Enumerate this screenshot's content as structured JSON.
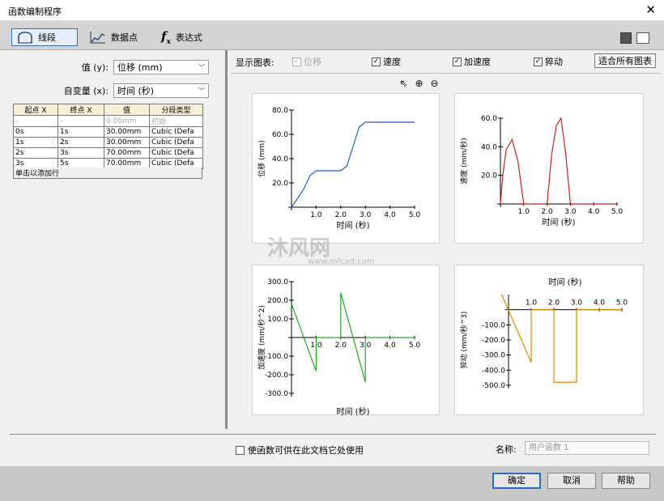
{
  "window": {
    "title": "函数编制程序"
  },
  "toolbar": {
    "tabs": [
      {
        "label": "线段"
      },
      {
        "label": "数据点"
      },
      {
        "label": "表达式"
      }
    ]
  },
  "left": {
    "value_label": "值 (y):",
    "value_select": "位移 (mm)",
    "indep_label": "自变量 (x):",
    "indep_select": "时间 (秒)",
    "table": {
      "headers": [
        "起点 X",
        "终点 X",
        "值",
        "分段类型"
      ],
      "rows": [
        [
          "-",
          "-",
          "0.00mm",
          "初始"
        ],
        [
          "0s",
          "1s",
          "30.00mm",
          "Cubic (Defa"
        ],
        [
          "1s",
          "2s",
          "30.00mm",
          "Cubic (Defa"
        ],
        [
          "2s",
          "3s",
          "70.00mm",
          "Cubic (Defa"
        ],
        [
          "3s",
          "5s",
          "70.00mm",
          "Cubic (Defa"
        ]
      ],
      "add_row": "单击以添加行"
    }
  },
  "right": {
    "show_label": "显示图表:",
    "checks": [
      {
        "label": "位移",
        "checked": true,
        "disabled": true
      },
      {
        "label": "速度",
        "checked": true
      },
      {
        "label": "加速度",
        "checked": true
      },
      {
        "label": "猝动",
        "checked": true
      }
    ],
    "fit_button": "适合所有图表"
  },
  "watermark": {
    "logo": "沐风网",
    "url": "www.mfcad.com"
  },
  "bottom": {
    "use_option": "使函数可供在此文档它处使用",
    "name_label": "名称:",
    "name_placeholder": "用户函数 1"
  },
  "buttons": {
    "ok": "确定",
    "cancel": "取消",
    "help": "帮助"
  },
  "colors": {
    "displacement": "#1f5fbf",
    "velocity": "#cc2222",
    "acceleration": "#22aa22",
    "jerk": "#e08a00",
    "active_tab": "#3a6ea5"
  },
  "chart_data": [
    {
      "type": "line",
      "name_key": "displacement",
      "ylabel": "位移 (mm)",
      "xlabel": "时间 (秒)",
      "xlim": [
        0,
        5
      ],
      "ylim": [
        0,
        80
      ],
      "xticks": [
        "1.0",
        "2.0",
        "3.0",
        "4.0",
        "5.0"
      ],
      "yticks": [
        "20.0",
        "40.0",
        "60.0",
        "80.0"
      ],
      "x": [
        0,
        0.25,
        0.5,
        0.75,
        1,
        1.5,
        2,
        2.25,
        2.5,
        2.75,
        3,
        4,
        5
      ],
      "y": [
        0,
        7.5,
        15,
        26,
        30,
        30,
        30,
        34,
        50,
        66,
        70,
        70,
        70
      ]
    },
    {
      "type": "line",
      "name_key": "velocity",
      "ylabel": "速度 (mm/秒)",
      "xlabel": "时间 (秒)",
      "xlim": [
        0,
        5
      ],
      "ylim": [
        0,
        60
      ],
      "xticks": [
        "1.0",
        "2.0",
        "3.0",
        "4.0",
        "5.0"
      ],
      "yticks": [
        "20.0",
        "40.0",
        "60.0"
      ],
      "x": [
        0,
        0.1,
        0.25,
        0.5,
        0.75,
        1,
        2,
        2.2,
        2.4,
        2.6,
        2.8,
        3,
        5
      ],
      "y": [
        0,
        20,
        38,
        45,
        30,
        0,
        0,
        35,
        55,
        60,
        35,
        0,
        0
      ]
    },
    {
      "type": "line",
      "name_key": "acceleration",
      "ylabel": "加速度 (mm/秒^2)",
      "xlabel": "时间 (秒)",
      "xlim": [
        0,
        5
      ],
      "ylim": [
        -300,
        300
      ],
      "xticks": [
        "1.0",
        "2.0",
        "3.0",
        "4.0",
        "5.0"
      ],
      "yticks": [
        "300.0",
        "200.0",
        "100.0",
        "-100.0",
        "-200.0",
        "-300.0"
      ],
      "x": [
        0,
        1,
        1,
        2,
        2,
        3,
        3,
        5
      ],
      "y": [
        180,
        -180,
        0,
        0,
        240,
        -240,
        0,
        0
      ]
    },
    {
      "type": "line",
      "name_key": "jerk",
      "ylabel": "猝动 (mm/秒^3)",
      "xlabel": "时间 (秒)",
      "xlim": [
        0,
        5
      ],
      "ylim": [
        -500,
        100
      ],
      "xticks": [
        "1.0",
        "2.0",
        "3.0",
        "4.0",
        "5.0"
      ],
      "yticks": [
        "-100.0",
        "-200.0",
        "-300.0",
        "-400.0",
        "-500.0"
      ],
      "x": [
        -0.3,
        1,
        1,
        1,
        2,
        2,
        3,
        3,
        5
      ],
      "y": [
        100,
        -350,
        -350,
        0,
        0,
        -480,
        -480,
        0,
        0
      ]
    }
  ]
}
